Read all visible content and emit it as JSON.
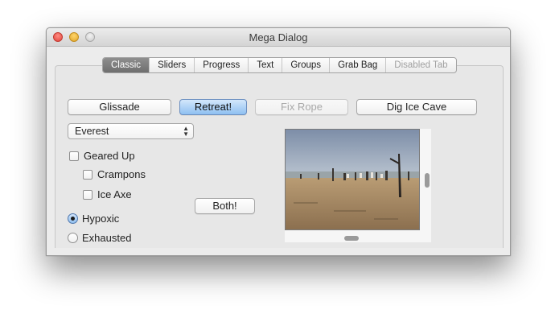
{
  "window": {
    "title": "Mega Dialog"
  },
  "tabs": [
    {
      "label": "Classic",
      "selected": true
    },
    {
      "label": "Sliders"
    },
    {
      "label": "Progress"
    },
    {
      "label": "Text"
    },
    {
      "label": "Groups"
    },
    {
      "label": "Grab Bag"
    },
    {
      "label": "Disabled Tab",
      "disabled": true
    }
  ],
  "buttons": {
    "glissade": "Glissade",
    "retreat": "Retreat!",
    "fix_rope": "Fix Rope",
    "dig_ice_cave": "Dig Ice Cave",
    "both": "Both!"
  },
  "popup": {
    "selected": "Everest"
  },
  "checkboxes": {
    "geared_up": "Geared Up",
    "crampons": "Crampons",
    "ice_axe": "Ice Axe"
  },
  "radios": {
    "hypoxic": "Hypoxic",
    "exhausted": "Exhausted",
    "selected": "Hypoxic"
  },
  "image": {
    "description": "beach photo with people"
  }
}
